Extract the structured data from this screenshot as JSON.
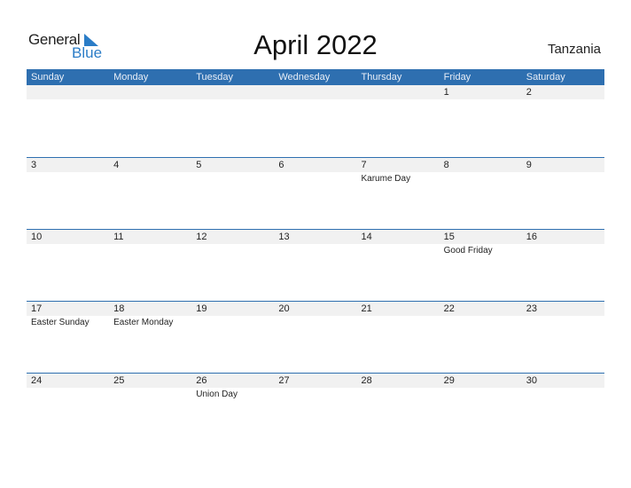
{
  "brand": {
    "part1": "General",
    "part2": "Blue",
    "accent": "#2a7cc7"
  },
  "title": "April 2022",
  "country": "Tanzania",
  "colors": {
    "header_bg": "#2e6fb0",
    "band_bg": "#f1f1f1"
  },
  "weekdays": [
    "Sunday",
    "Monday",
    "Tuesday",
    "Wednesday",
    "Thursday",
    "Friday",
    "Saturday"
  ],
  "weeks": [
    {
      "days": [
        {
          "num": "",
          "holiday": ""
        },
        {
          "num": "",
          "holiday": ""
        },
        {
          "num": "",
          "holiday": ""
        },
        {
          "num": "",
          "holiday": ""
        },
        {
          "num": "",
          "holiday": ""
        },
        {
          "num": "1",
          "holiday": ""
        },
        {
          "num": "2",
          "holiday": ""
        }
      ]
    },
    {
      "days": [
        {
          "num": "3",
          "holiday": ""
        },
        {
          "num": "4",
          "holiday": ""
        },
        {
          "num": "5",
          "holiday": ""
        },
        {
          "num": "6",
          "holiday": ""
        },
        {
          "num": "7",
          "holiday": "Karume Day"
        },
        {
          "num": "8",
          "holiday": ""
        },
        {
          "num": "9",
          "holiday": ""
        }
      ]
    },
    {
      "days": [
        {
          "num": "10",
          "holiday": ""
        },
        {
          "num": "11",
          "holiday": ""
        },
        {
          "num": "12",
          "holiday": ""
        },
        {
          "num": "13",
          "holiday": ""
        },
        {
          "num": "14",
          "holiday": ""
        },
        {
          "num": "15",
          "holiday": "Good Friday"
        },
        {
          "num": "16",
          "holiday": ""
        }
      ]
    },
    {
      "days": [
        {
          "num": "17",
          "holiday": "Easter Sunday"
        },
        {
          "num": "18",
          "holiday": "Easter Monday"
        },
        {
          "num": "19",
          "holiday": ""
        },
        {
          "num": "20",
          "holiday": ""
        },
        {
          "num": "21",
          "holiday": ""
        },
        {
          "num": "22",
          "holiday": ""
        },
        {
          "num": "23",
          "holiday": ""
        }
      ]
    },
    {
      "days": [
        {
          "num": "24",
          "holiday": ""
        },
        {
          "num": "25",
          "holiday": ""
        },
        {
          "num": "26",
          "holiday": "Union Day"
        },
        {
          "num": "27",
          "holiday": ""
        },
        {
          "num": "28",
          "holiday": ""
        },
        {
          "num": "29",
          "holiday": ""
        },
        {
          "num": "30",
          "holiday": ""
        }
      ]
    }
  ]
}
